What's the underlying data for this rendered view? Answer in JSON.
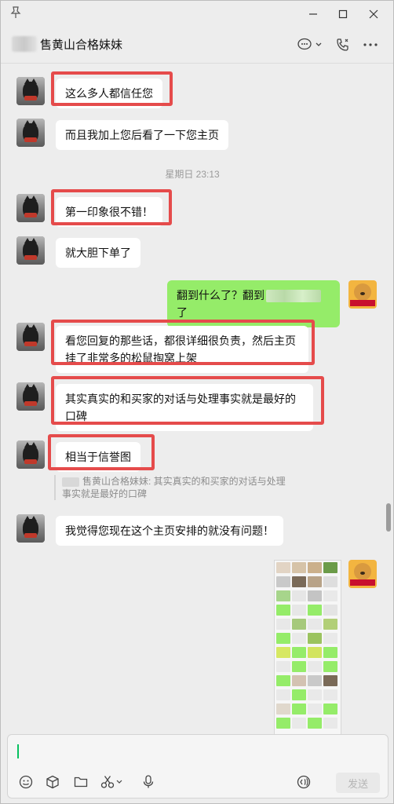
{
  "chat": {
    "title": "售黄山合格妹妹"
  },
  "messages": [
    {
      "side": "left",
      "text": "这么多人都信任您",
      "highlighted": true
    },
    {
      "side": "left",
      "text": "而且我加上您后看了一下您主页",
      "highlighted": false
    },
    {
      "side": "time",
      "text": "星期日 23:13"
    },
    {
      "side": "left",
      "text": "第一印象很不错！",
      "highlighted": true
    },
    {
      "side": "left",
      "text": "就大胆下单了",
      "highlighted": false
    },
    {
      "side": "right",
      "text_before": "翻到什么了？翻到",
      "text_after": "了"
    },
    {
      "side": "left",
      "text": "看您回复的那些话，都很详细很负责，然后主页挂了非常多的松鼠掏窝上架",
      "highlighted": true
    },
    {
      "side": "left",
      "text": "其实真实的和买家的对话与处理事实就是最好的口碑",
      "highlighted": true
    },
    {
      "side": "left",
      "text": "相当于信誉图",
      "highlighted": true
    },
    {
      "side": "quote",
      "text": "售黄山合格妹妹: 其实真实的和买家的对话与处理事实就是最好的口碑"
    },
    {
      "side": "left",
      "text": "我觉得您现在这个主页安排的就没有问题！",
      "highlighted": false
    },
    {
      "side": "right-image",
      "text": ""
    }
  ],
  "input": {
    "value": "",
    "send_label": "发送"
  },
  "icons": {
    "pin": "pin-icon",
    "minimize": "minimize-icon",
    "maximize": "maximize-icon",
    "close": "close-icon",
    "chat_bubble": "chat-bubble-icon",
    "call": "phone-icon",
    "more": "more-icon",
    "emoji": "emoji-icon",
    "favorites": "cube-icon",
    "file": "folder-icon",
    "screenshot": "scissors-icon",
    "voice": "microphone-icon",
    "voice_input": "voice-input-icon"
  },
  "colors": {
    "highlight": "#e54b4b",
    "self_bubble": "#95ec69",
    "other_bubble": "#ffffff",
    "caret": "#07c160"
  }
}
